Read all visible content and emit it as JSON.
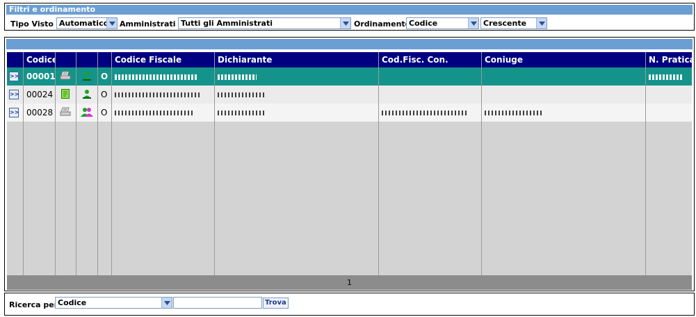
{
  "filters": {
    "title": "Filtri e ordinamento",
    "tipo_visto_label": "Tipo Visto :",
    "tipo_visto_value": "Automatico",
    "amministrati_label": "Amministrati :",
    "amministrati_value": "Tutti gli Amministrati",
    "ordinamento_label": "Ordinamento",
    "ordinamento_value": "Codice",
    "direzione_value": "Crescente"
  },
  "grid": {
    "columns": [
      "Codice",
      "",
      "",
      "",
      "Codice Fiscale",
      "Dichiarante",
      "Cod.Fisc. Con.",
      "Coniuge",
      "N. Pratica"
    ],
    "rows": [
      {
        "nav": ">>",
        "codice": "00001",
        "tipo": "O",
        "doc_icon": "printer-icon",
        "person_icon": "single-person-icon"
      },
      {
        "nav": ">>",
        "codice": "00024",
        "tipo": "O",
        "doc_icon": "document-green-icon",
        "person_icon": "single-person-icon"
      },
      {
        "nav": ">>",
        "codice": "00028",
        "tipo": "O",
        "doc_icon": "printer-icon",
        "person_icon": "couple-icon"
      }
    ],
    "page": "1"
  },
  "search": {
    "label": "Ricerca per",
    "field_value": "Codice",
    "query": "",
    "button_label": "Trova"
  },
  "colors": {
    "header_blue": "#6b9fd3",
    "grid_header": "#000080",
    "selected_row": "#14938a"
  }
}
